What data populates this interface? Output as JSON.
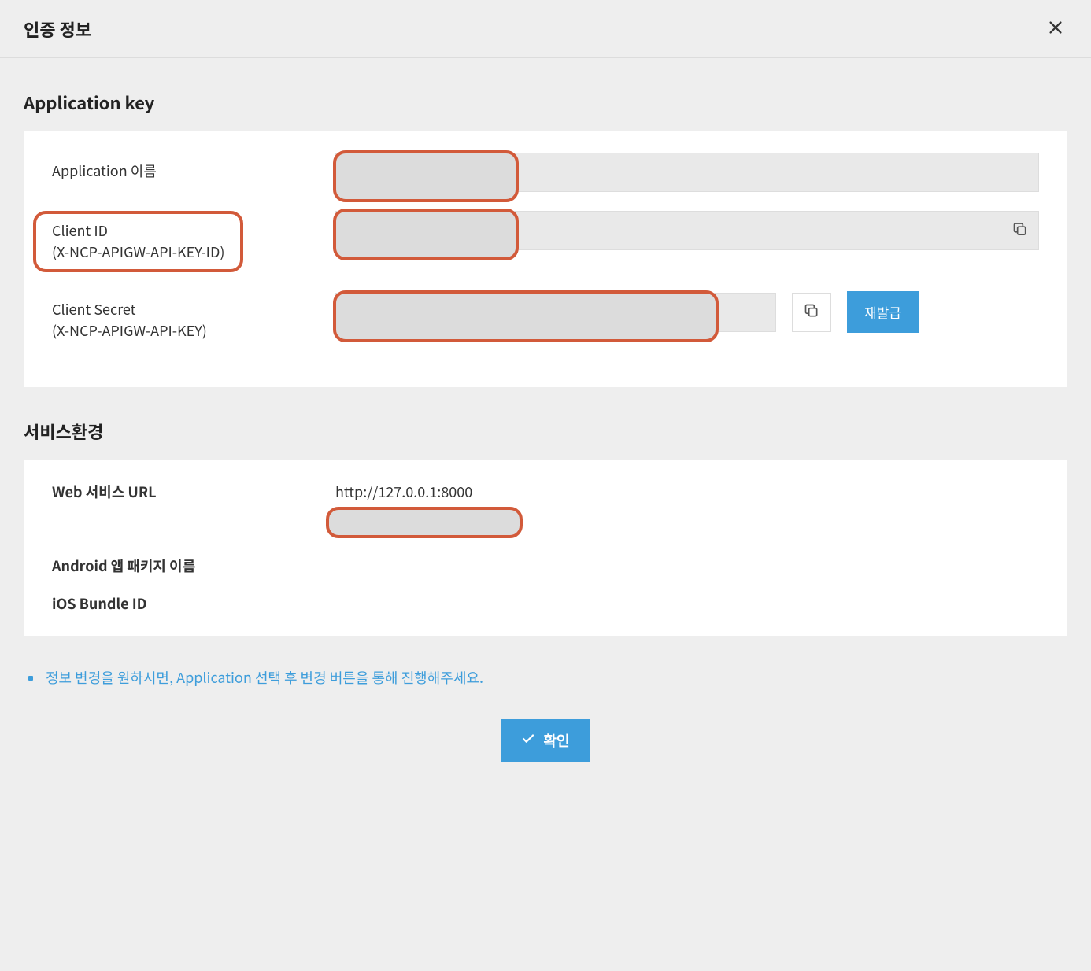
{
  "header": {
    "title": "인증 정보"
  },
  "appkey": {
    "section_title": "Application key",
    "app_name_label": "Application 이름",
    "client_id_label_line1": "Client ID",
    "client_id_label_line2": "(X-NCP-APIGW-API-KEY-ID)",
    "client_secret_label_line1": "Client Secret",
    "client_secret_label_line2": "(X-NCP-APIGW-API-KEY)",
    "reissue_label": "재발급"
  },
  "env": {
    "section_title": "서비스환경",
    "web_url_label": "Web 서비스 URL",
    "web_url_value": "http://127.0.0.1:8000",
    "android_label": "Android 앱 패키지 이름",
    "ios_label": "iOS Bundle ID"
  },
  "info": {
    "text": "정보 변경을 원하시면, Application 선택 후 변경 버튼을 통해 진행해주세요."
  },
  "footer": {
    "confirm_label": "확인"
  }
}
